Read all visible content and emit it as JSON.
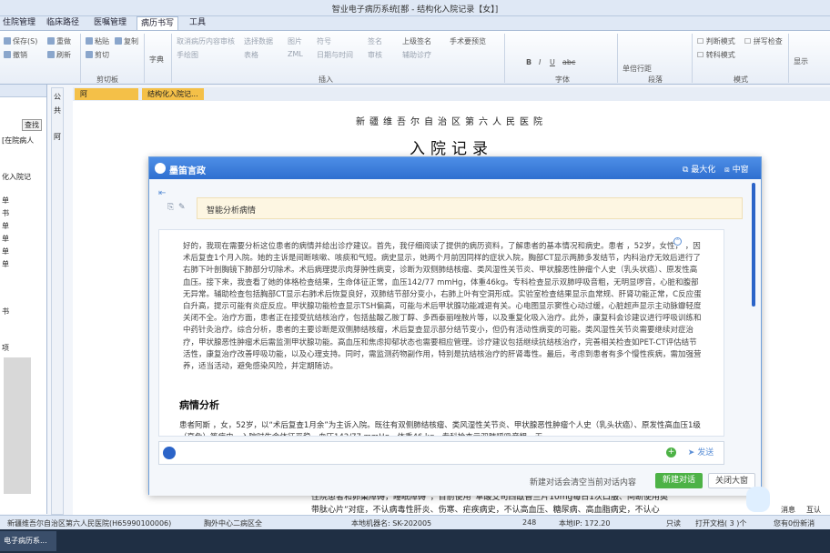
{
  "window": {
    "title": "智业电子病历系统[鄯                    - 结构化入院记录【女】]"
  },
  "tabs": [
    "住院管理",
    "临床路径",
    "医嘱管理",
    "病历书写",
    "工具"
  ],
  "ribbon": {
    "file_group": {
      "save": "保存(S)",
      "undo": "撤销",
      "redo": "重做",
      "refresh": "刷新"
    },
    "clipboard_group": {
      "label": "剪切板",
      "paste": "粘贴",
      "copy": "复制",
      "cut": "剪切"
    },
    "style_label": "字典",
    "insert_group": {
      "label": "插入",
      "cancel_review": "取消病历内容审核",
      "select_data": "选择数据",
      "picture": "图片",
      "symbol": "符号",
      "sign_img": "签名",
      "upgrade_sign": "上级签名",
      "handsign_preview": "手术要预览",
      "handwrite": "手绘图",
      "table": "表格",
      "zml": "ZML",
      "datetime": "日期与时间",
      "review": "审核",
      "assist": "辅助诊疗"
    },
    "font_group": {
      "label": "字体",
      "bold": "B",
      "italic": "I",
      "underline": "U",
      "strike": "abc"
    },
    "para_group": {
      "label": "段落",
      "linespacing": "单倍行距"
    },
    "mode_group": {
      "label": "模式",
      "revision": "判断模式",
      "spell": "拼写检查",
      "convert": "转科模式"
    },
    "display_label": "显示"
  },
  "left_pane": {
    "search_button": "查找",
    "filter_label": "[在院病人",
    "items": [
      "化入院记",
      "单",
      "书",
      "单",
      "单",
      "单",
      "单",
      "书",
      "项"
    ]
  },
  "vertical_tab": {
    "items": [
      "公",
      "共",
      "阿"
    ]
  },
  "doc_tabs": [
    "阿",
    "结构化入院记..."
  ],
  "document": {
    "hospital": "新疆维吾尔自治区第六人民医院",
    "title": "入院记录",
    "behind_line1": "住院患者和卵巢障碍，睡眠障碍”，目前使用“草酸艾司西酞普兰片10mg每日1次口服、间断使用奥",
    "behind_line2": "带肽心片”对症，不认病毒性肝炎、伤寒、疟疾病史，不认高血压、糖尿病、高血脂病史，不认心"
  },
  "assistant": {
    "brand": "墨笛言政",
    "maximize": "最大化",
    "middle": "中窗",
    "query": "智能分析病情",
    "answer_intro": "好的，我现在需要分析这位患者的病情并给出诊疗建议。首先，我仔细阅读了提供的病历资料，了解患者的基本情况和病史。患者        ，52岁，女性，        ，因术后复查1个月入院。她的主诉是间断咳嗽、咳痰和气短。病史显示，她两个月前因同样的症状入院，胸部CT显示两肺多发结节，内科治疗无效后进行了右肺下叶剖胸镜下肺部分切除术。术后病理提示肉芽肿性病变，诊断为双侧肺结核瘤、类风湿性关节炎、甲状腺恶性肿瘤个人史（乳头状癌）、原发性高血压。接下来，我查看了她的体格检查结果，生命体征正常，血压142/77 mmHg，体重46kg。专科检查显示双肺呼吸音粗，无明显啰音，心脏和腹部无异常。辅助检查包括胸部CT显示右肺术后恢复良好，双肺结节部分变小，右肺上叶有空洞形成。实验室检查结果显示血常规、肝肾功能正常，C反应蛋白升高，提示可能有炎症反应。甲状腺功能检查显示TSH偏高，可能与术后甲状腺功能减退有关。心电图显示窦性心动过缓，心脏超声显示主动脉瓣轻度关闭不全。治疗方面，患者正在接受抗结核治疗，包括盐酸乙胺丁醇、多西泰丽唑胺片等，以及重复化吸入治疗。此外，康复科会诊建议进行呼吸训练和中药针灸治疗。综合分析，患者的主要诊断是双侧肺结核瘤，术后复查显示部分结节变小，但仍有活动性病变的可能。类风湿性关节炎需要继续对症治疗，甲状腺恶性肿瘤术后需监测甲状腺功能。高血压和焦虑抑郁状态也需要相应管理。诊疗建议包括继续抗结核治疗，完善相关检查如PET-CT评估结节活性，康复治疗改善呼吸功能，以及心理支持。同时，需监测药物副作用，特别是抗结核治疗的肝肾毒性。最后，考虑到患者有多个慢性疾病，需加强营养，适当活动，避免感染风险，并定期随访。",
    "section_title": "病情分析",
    "section_text": "患者阿斯        ，女，52岁，以“术后复查1月余”为主诉入院。既往有双侧肺结核瘤、类风湿性关节炎、甲状腺恶性肿瘤个人史（乳头状癌）、原发性高血压1级（高危）等病史，入院时生命体征平稳，血压142/77 mmHg，体重46 kg，专科检查示双肺呼吸音粗，无",
    "send": "发送",
    "new_chat_hint": "新建对话会清空当前对话内容",
    "new_chat": "新建对话",
    "close": "关闭大窗"
  },
  "right_widget": {
    "msg": "消息",
    "interact": "互认"
  },
  "status_bar": {
    "hospital": "新疆维吾尔自治区第六人民医院(H65990100006)",
    "dept": "胸外中心二病区全",
    "machine": "本地机器名: SK-202005",
    "num": "248",
    "ip": "本地IP: 172.20",
    "role": "只读",
    "open_docs": "打开文档( 3 )个",
    "user": "您有0份新消"
  },
  "taskbar": {
    "item": "电子病历系..."
  }
}
